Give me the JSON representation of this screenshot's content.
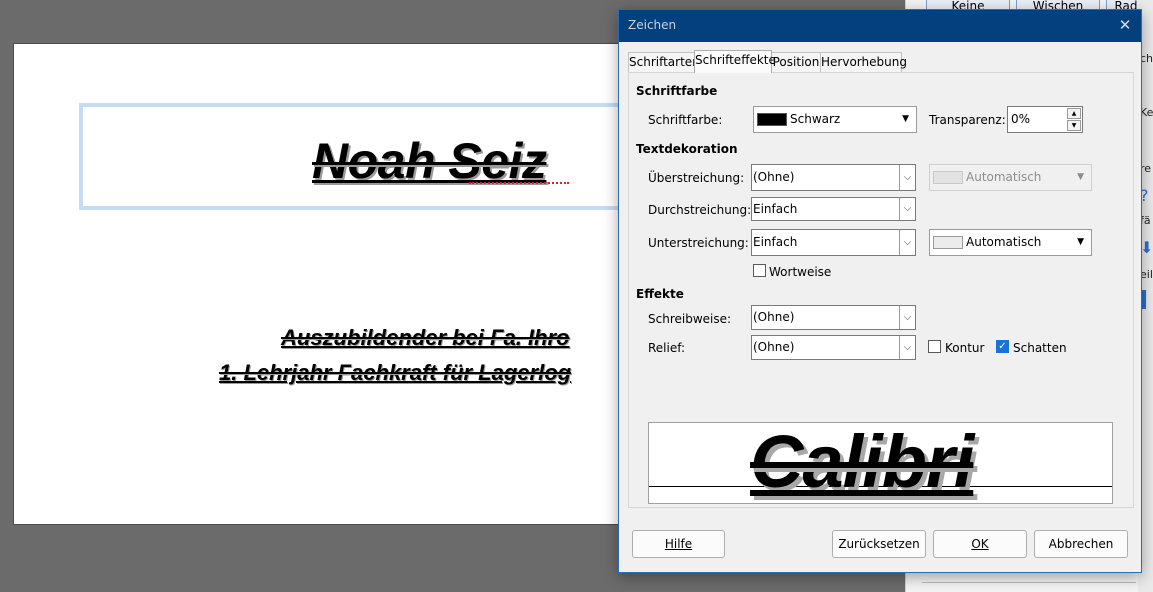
{
  "document": {
    "title": "Noah Seiz",
    "line1": "Auszubildender bei Fa. Ihro",
    "line2": "1. Lehrjahr Fachkraft für Lagerlog"
  },
  "side_panel": {
    "btn_keine": "Keine",
    "btn_wischen": "Wischen",
    "btn_rad": "Rad",
    "frag_ch": "ch",
    "frag_kei": "Kei",
    "frag_re": "re",
    "frag_fa": "fä",
    "frag_eile": "eile"
  },
  "dialog": {
    "title": "Zeichen",
    "tabs": [
      {
        "label": "Schriftarten"
      },
      {
        "label": "Schrifteffekte"
      },
      {
        "label": "Position"
      },
      {
        "label": "Hervorhebung"
      }
    ],
    "sections": {
      "fontcolor": "Schriftfarbe",
      "decoration": "Textdekoration",
      "effects": "Effekte"
    },
    "fontcolor": {
      "label": "Schriftfarbe:",
      "value": "Schwarz",
      "swatch": "#000000",
      "transparency_label": "Transparenz:",
      "transparency_value": "0%"
    },
    "overline": {
      "label": "Überstreichung:",
      "value": "(Ohne)",
      "color": "Automatisch"
    },
    "strikethrough": {
      "label": "Durchstreichung:",
      "value": "Einfach"
    },
    "underline": {
      "label": "Unterstreichung:",
      "value": "Einfach",
      "color": "Automatisch"
    },
    "wordwise": {
      "label": "Wortweise",
      "checked": false
    },
    "case": {
      "label": "Schreibweise:",
      "value": "(Ohne)"
    },
    "relief": {
      "label": "Relief:",
      "value": "(Ohne)"
    },
    "outline": {
      "label": "Kontur",
      "checked": false
    },
    "shadow": {
      "label": "Schatten",
      "checked": true
    },
    "preview_text": "Calibri",
    "buttons": {
      "help": "Hilfe",
      "reset": "Zurücksetzen",
      "ok": "OK",
      "cancel": "Abbrechen"
    },
    "colors": {
      "titlebar": "#05407e",
      "check_accent": "#1a73d6"
    }
  }
}
